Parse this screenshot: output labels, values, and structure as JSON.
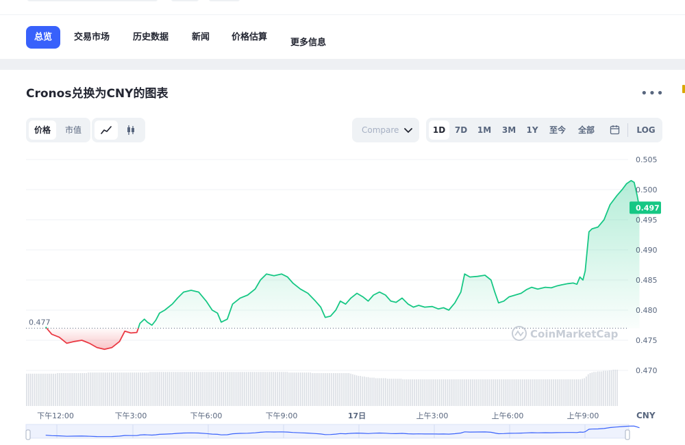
{
  "nav": {
    "tabs": [
      {
        "label": "总览",
        "active": true
      },
      {
        "label": "交易市场",
        "active": false
      },
      {
        "label": "历史数据",
        "active": false
      },
      {
        "label": "新闻",
        "active": false
      },
      {
        "label": "价格估算",
        "active": false
      },
      {
        "label": "更多信息",
        "active": false
      }
    ]
  },
  "chart_header": {
    "title": "Cronos兑换为CNY的图表",
    "more_icon": "more-horizontal-icon"
  },
  "controls": {
    "metric": [
      "价格",
      "市值"
    ],
    "metric_selected": "价格",
    "chart_style_icons": [
      "line-chart-icon",
      "candlestick-icon"
    ],
    "compare_label": "Compare",
    "ranges": [
      "1D",
      "7D",
      "1M",
      "3M",
      "1Y",
      "至今",
      "全部"
    ],
    "range_selected": "1D",
    "calendar_icon": "calendar-icon",
    "log_label": "LOG"
  },
  "chart_data": {
    "type": "area",
    "currency": "CNY",
    "watermark": "CoinMarketCap",
    "ylim": [
      0.465,
      0.506
    ],
    "y_ticks": [
      0.505,
      0.5,
      0.495,
      0.49,
      0.485,
      0.48,
      0.475,
      0.47
    ],
    "y_tick_labels": [
      "0.505",
      "0.500",
      "0.495",
      "0.490",
      "0.485",
      "0.480",
      "0.475",
      "0.470"
    ],
    "reference_price": 0.477,
    "reference_label": "0.477",
    "current_price": 0.497,
    "current_label": "0.497",
    "colors": {
      "up": "#16c784",
      "down": "#ea3943",
      "up_fill": "#16c784",
      "down_fill": "#ea3943",
      "volume": "#d9dde3",
      "current_badge": "#16c784"
    },
    "xlim": [
      -0.13,
      8.0
    ],
    "x_ticks": [
      0,
      1,
      2,
      3,
      4,
      5,
      6,
      7
    ],
    "x_tick_labels": [
      "下午12:00",
      "下午3:00",
      "下午6:00",
      "下午9:00",
      "17日",
      "上午3:00",
      "上午6:00",
      "上午9:00"
    ],
    "x_unit_label": "CNY",
    "series": [
      {
        "points": [
          [
            -0.13,
            0.4772
          ],
          [
            -0.05,
            0.476
          ],
          [
            0.05,
            0.4755
          ],
          [
            0.15,
            0.4745
          ],
          [
            0.25,
            0.4748
          ],
          [
            0.35,
            0.475
          ],
          [
            0.45,
            0.4745
          ],
          [
            0.55,
            0.4738
          ],
          [
            0.65,
            0.4735
          ],
          [
            0.75,
            0.4738
          ],
          [
            0.85,
            0.4748
          ],
          [
            0.92,
            0.4765
          ],
          [
            1.0,
            0.4762
          ],
          [
            1.08,
            0.4763
          ],
          [
            1.12,
            0.4778
          ],
          [
            1.18,
            0.4785
          ],
          [
            1.22,
            0.478
          ],
          [
            1.28,
            0.4775
          ],
          [
            1.33,
            0.4783
          ],
          [
            1.38,
            0.4795
          ],
          [
            1.45,
            0.48
          ],
          [
            1.55,
            0.481
          ],
          [
            1.62,
            0.482
          ],
          [
            1.7,
            0.483
          ],
          [
            1.8,
            0.4833
          ],
          [
            1.9,
            0.483
          ],
          [
            2.0,
            0.4815
          ],
          [
            2.08,
            0.48
          ],
          [
            2.15,
            0.4795
          ],
          [
            2.2,
            0.478
          ],
          [
            2.28,
            0.4785
          ],
          [
            2.35,
            0.481
          ],
          [
            2.45,
            0.482
          ],
          [
            2.55,
            0.4825
          ],
          [
            2.65,
            0.4835
          ],
          [
            2.72,
            0.485
          ],
          [
            2.8,
            0.486
          ],
          [
            2.9,
            0.4857
          ],
          [
            3.0,
            0.486
          ],
          [
            3.08,
            0.4855
          ],
          [
            3.15,
            0.4845
          ],
          [
            3.25,
            0.4835
          ],
          [
            3.35,
            0.4828
          ],
          [
            3.45,
            0.4815
          ],
          [
            3.52,
            0.4805
          ],
          [
            3.58,
            0.4788
          ],
          [
            3.65,
            0.479
          ],
          [
            3.72,
            0.48
          ],
          [
            3.78,
            0.4815
          ],
          [
            3.85,
            0.481
          ],
          [
            3.92,
            0.482
          ],
          [
            4.0,
            0.4828
          ],
          [
            4.08,
            0.4822
          ],
          [
            4.15,
            0.4815
          ],
          [
            4.22,
            0.4825
          ],
          [
            4.3,
            0.483
          ],
          [
            4.38,
            0.4825
          ],
          [
            4.45,
            0.4815
          ],
          [
            4.52,
            0.4813
          ],
          [
            4.6,
            0.482
          ],
          [
            4.68,
            0.481
          ],
          [
            4.75,
            0.4805
          ],
          [
            4.82,
            0.4808
          ],
          [
            4.9,
            0.4805
          ],
          [
            5.0,
            0.4806
          ],
          [
            5.08,
            0.4802
          ],
          [
            5.15,
            0.4804
          ],
          [
            5.22,
            0.48
          ],
          [
            5.3,
            0.4812
          ],
          [
            5.38,
            0.483
          ],
          [
            5.43,
            0.486
          ],
          [
            5.5,
            0.4855
          ],
          [
            5.6,
            0.4856
          ],
          [
            5.7,
            0.4858
          ],
          [
            5.78,
            0.485
          ],
          [
            5.83,
            0.483
          ],
          [
            5.88,
            0.4812
          ],
          [
            5.95,
            0.4815
          ],
          [
            6.02,
            0.4822
          ],
          [
            6.1,
            0.4825
          ],
          [
            6.18,
            0.4828
          ],
          [
            6.25,
            0.4834
          ],
          [
            6.32,
            0.4838
          ],
          [
            6.4,
            0.4835
          ],
          [
            6.5,
            0.4838
          ],
          [
            6.58,
            0.4837
          ],
          [
            6.65,
            0.484
          ],
          [
            6.72,
            0.4842
          ],
          [
            6.8,
            0.4844
          ],
          [
            6.87,
            0.4845
          ],
          [
            6.92,
            0.4843
          ],
          [
            6.96,
            0.4855
          ],
          [
            7.0,
            0.485
          ],
          [
            7.03,
            0.4865
          ],
          [
            7.08,
            0.493
          ],
          [
            7.12,
            0.4935
          ],
          [
            7.2,
            0.4938
          ],
          [
            7.28,
            0.495
          ],
          [
            7.36,
            0.4975
          ],
          [
            7.45,
            0.499
          ],
          [
            7.52,
            0.5
          ],
          [
            7.58,
            0.501
          ],
          [
            7.64,
            0.5015
          ],
          [
            7.68,
            0.5012
          ],
          [
            7.72,
            0.499
          ],
          [
            7.75,
            0.497
          ]
        ]
      }
    ],
    "volume": [
      0.57,
      0.57,
      0.57,
      0.57,
      0.57,
      0.57,
      0.57,
      0.57,
      0.57,
      0.57,
      0.57,
      0.57,
      0.57,
      0.57,
      0.57,
      0.57,
      0.58,
      0.58,
      0.58,
      0.58,
      0.58,
      0.58,
      0.58,
      0.58,
      0.58,
      0.58,
      0.58,
      0.58,
      0.58,
      0.58,
      0.58,
      0.58,
      0.59,
      0.59,
      0.59,
      0.59,
      0.59,
      0.59,
      0.59,
      0.59,
      0.59,
      0.59,
      0.59,
      0.59,
      0.59,
      0.59,
      0.59,
      0.59,
      0.59,
      0.59,
      0.59,
      0.59,
      0.59,
      0.59,
      0.59,
      0.59,
      0.59,
      0.59,
      0.59,
      0.59,
      0.59,
      0.59,
      0.59,
      0.59,
      0.6,
      0.6,
      0.6,
      0.6,
      0.6,
      0.6,
      0.6,
      0.6,
      0.6,
      0.6,
      0.6,
      0.6,
      0.6,
      0.6,
      0.6,
      0.6,
      0.6,
      0.6,
      0.6,
      0.6,
      0.6,
      0.6,
      0.6,
      0.6,
      0.6,
      0.6,
      0.6,
      0.6,
      0.6,
      0.6,
      0.6,
      0.6,
      0.6,
      0.6,
      0.6,
      0.6,
      0.6,
      0.6,
      0.6,
      0.6,
      0.6,
      0.6,
      0.6,
      0.6,
      0.6,
      0.6,
      0.6,
      0.6,
      0.6,
      0.6,
      0.6,
      0.6,
      0.6,
      0.6,
      0.6,
      0.6,
      0.6,
      0.6,
      0.6,
      0.6,
      0.6,
      0.6,
      0.6,
      0.6,
      0.6,
      0.6,
      0.6,
      0.6,
      0.6,
      0.6,
      0.6,
      0.6,
      0.59,
      0.59,
      0.59,
      0.59,
      0.59,
      0.59,
      0.59,
      0.59,
      0.59,
      0.59,
      0.59,
      0.59,
      0.58,
      0.58,
      0.58,
      0.58,
      0.58,
      0.58,
      0.58,
      0.58,
      0.58,
      0.58,
      0.58,
      0.58,
      0.58,
      0.58,
      0.58,
      0.58,
      0.58,
      0.58,
      0.58,
      0.58,
      0.57,
      0.56,
      0.55,
      0.54,
      0.53,
      0.53,
      0.52,
      0.52,
      0.51,
      0.51,
      0.5,
      0.5,
      0.5,
      0.49,
      0.49,
      0.49,
      0.49,
      0.49,
      0.49,
      0.48,
      0.48,
      0.48,
      0.48,
      0.48,
      0.48,
      0.48,
      0.48,
      0.47,
      0.47,
      0.47,
      0.47,
      0.47,
      0.47,
      0.47,
      0.47,
      0.47,
      0.47,
      0.47,
      0.47,
      0.47,
      0.47,
      0.47,
      0.47,
      0.47,
      0.47,
      0.47,
      0.47,
      0.47,
      0.47,
      0.47,
      0.47,
      0.47,
      0.47,
      0.47,
      0.47,
      0.47,
      0.47,
      0.47,
      0.47,
      0.47,
      0.47,
      0.47,
      0.47,
      0.47,
      0.47,
      0.47,
      0.47,
      0.47,
      0.47,
      0.47,
      0.47,
      0.47,
      0.47,
      0.47,
      0.47,
      0.47,
      0.47,
      0.47,
      0.47,
      0.47,
      0.47,
      0.47,
      0.47,
      0.47,
      0.47,
      0.47,
      0.47,
      0.47,
      0.47,
      0.47,
      0.47,
      0.47,
      0.47,
      0.47,
      0.47,
      0.47,
      0.47,
      0.47,
      0.47,
      0.47,
      0.47,
      0.47,
      0.47,
      0.47,
      0.47,
      0.47,
      0.47,
      0.47,
      0.47,
      0.47,
      0.47,
      0.47,
      0.47,
      0.47,
      0.47,
      0.47,
      0.47,
      0.47,
      0.47,
      0.47,
      0.48,
      0.49,
      0.52,
      0.56,
      0.58,
      0.59,
      0.6,
      0.6,
      0.61,
      0.61,
      0.61,
      0.62,
      0.62,
      0.62,
      0.63,
      0.63,
      0.64,
      0.64,
      0.64
    ]
  }
}
